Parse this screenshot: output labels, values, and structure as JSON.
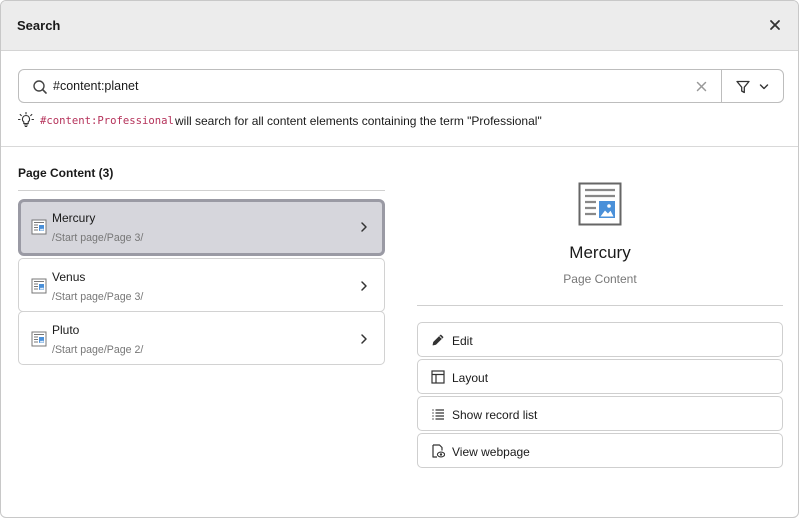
{
  "dialog": {
    "title": "Search",
    "close_icon": "close-icon"
  },
  "search": {
    "value": "#content:planet",
    "placeholder": "",
    "search_icon": "search-icon",
    "clear_icon": "clear-icon",
    "filter_icon": "filter-icon"
  },
  "hint": {
    "code": "#content:Professional",
    "text": "will search for all content elements containing the term \"Professional\"",
    "icon": "lightbulb-icon"
  },
  "results": {
    "heading": "Page Content (3)",
    "items": [
      {
        "title": "Mercury",
        "path": "/Start page/Page 3/",
        "active": true
      },
      {
        "title": "Venus",
        "path": "/Start page/Page 3/",
        "active": false
      },
      {
        "title": "Pluto",
        "path": "/Start page/Page 2/",
        "active": false
      }
    ]
  },
  "preview": {
    "title": "Mercury",
    "subtitle": "Page Content",
    "icon": "content-element-icon"
  },
  "actions": [
    {
      "label": "Edit",
      "icon": "pencil-icon"
    },
    {
      "label": "Layout",
      "icon": "layout-icon"
    },
    {
      "label": "Show record list",
      "icon": "list-icon"
    },
    {
      "label": "View webpage",
      "icon": "view-page-icon"
    }
  ],
  "colors": {
    "header_bg": "#ececec",
    "active_result_bg": "#d6d6dc",
    "active_result_border": "#9a9aa4",
    "code_color": "#b5325a",
    "icon_blue": "#4a90d9"
  }
}
